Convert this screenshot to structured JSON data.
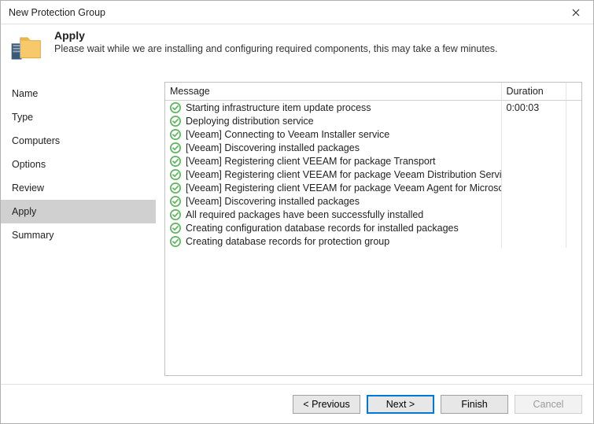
{
  "window": {
    "title": "New Protection Group"
  },
  "header": {
    "title": "Apply",
    "subtitle": "Please wait while we are installing and configuring required components, this may take a few minutes."
  },
  "sidebar": {
    "items": [
      {
        "label": "Name"
      },
      {
        "label": "Type"
      },
      {
        "label": "Computers"
      },
      {
        "label": "Options"
      },
      {
        "label": "Review"
      },
      {
        "label": "Apply"
      },
      {
        "label": "Summary"
      }
    ],
    "active_index": 5
  },
  "table": {
    "columns": {
      "message": "Message",
      "duration": "Duration"
    },
    "rows": [
      {
        "status": "success",
        "message": "Starting infrastructure item update process",
        "duration": "0:00:03"
      },
      {
        "status": "success",
        "message": "Deploying distribution service",
        "duration": ""
      },
      {
        "status": "success",
        "message": "[Veeam] Connecting to Veeam Installer service",
        "duration": ""
      },
      {
        "status": "success",
        "message": "[Veeam] Discovering installed packages",
        "duration": ""
      },
      {
        "status": "success",
        "message": "[Veeam] Registering client VEEAM for package Transport",
        "duration": ""
      },
      {
        "status": "success",
        "message": "[Veeam] Registering client VEEAM for package Veeam Distribution Service",
        "duration": ""
      },
      {
        "status": "success",
        "message": "[Veeam] Registering client VEEAM for package Veeam Agent for Microsoft W...",
        "duration": ""
      },
      {
        "status": "success",
        "message": "[Veeam] Discovering installed packages",
        "duration": ""
      },
      {
        "status": "success",
        "message": "All required packages have been successfully installed",
        "duration": ""
      },
      {
        "status": "success",
        "message": "Creating configuration database records for installed packages",
        "duration": ""
      },
      {
        "status": "success",
        "message": "Creating database records for protection group",
        "duration": ""
      }
    ]
  },
  "footer": {
    "previous": "< Previous",
    "next": "Next >",
    "finish": "Finish",
    "cancel": "Cancel"
  },
  "colors": {
    "success": "#5fb75f"
  }
}
